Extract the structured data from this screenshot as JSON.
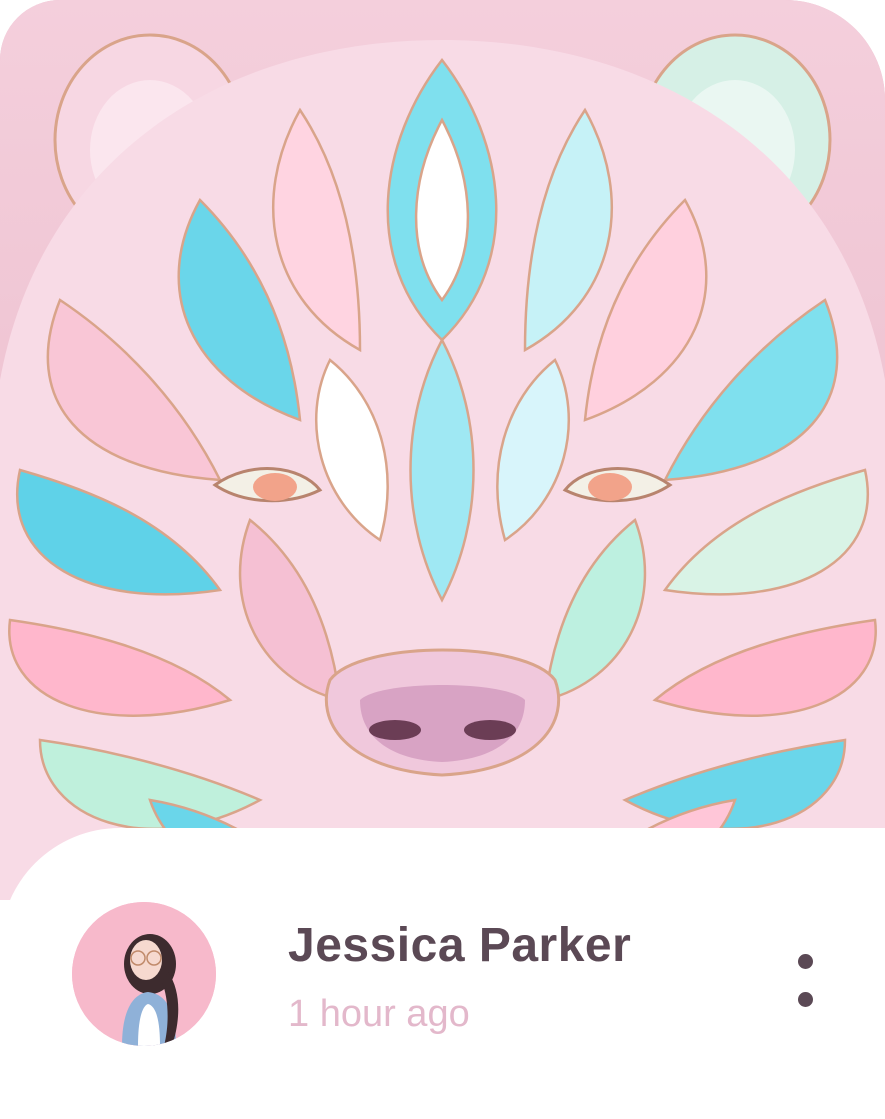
{
  "post": {
    "artwork_icon": "bear-artwork",
    "author_name": "Jessica Parker",
    "timestamp": "1 hour ago",
    "more_icon": "more-vertical-icon"
  },
  "colors": {
    "background_pink": "#e9b8c8",
    "name_text": "#5b4955",
    "time_text": "#e3b8cb",
    "avatar_bg": "#f7b9cb"
  }
}
